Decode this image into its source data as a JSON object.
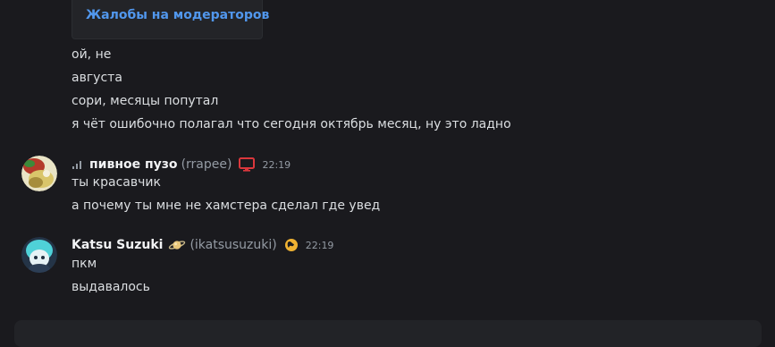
{
  "embed": {
    "link_label": "Жалобы на модераторов"
  },
  "continued_messages": [
    "ой, не",
    "августа",
    "сори, месяцы попутал",
    "я чёт ошибочно полагал что сегодня октябрь месяц, ну это ладно"
  ],
  "message_groups": [
    {
      "username": "пивное пузо",
      "handle": "(rrapee)",
      "timestamp": "22:19",
      "lines": [
        "ты красавчик",
        "а почему ты мне не хамстера сделал где увед"
      ],
      "icons": [
        "signal-bars-icon",
        "desktop-monitor-icon"
      ]
    },
    {
      "username": "Katsu Suzuki",
      "handle": "(ikatsusuzuki)",
      "timestamp": "22:19",
      "lines": [
        "пкм",
        "выдавалось"
      ],
      "icons": [
        "planet-icon",
        "globe-icon"
      ]
    }
  ],
  "colors": {
    "background": "#1a1a1e",
    "text": "#dbdee1",
    "muted": "#949ba4",
    "link": "#5197ed",
    "desktop_icon": "#da373c",
    "globe_icon": "#f0b232"
  }
}
